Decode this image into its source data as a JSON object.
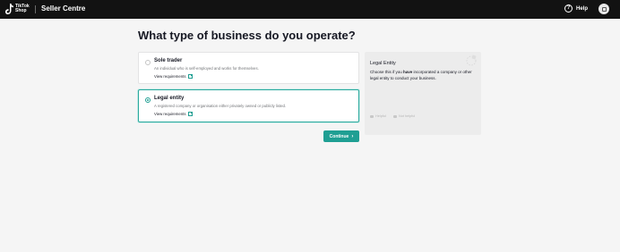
{
  "header": {
    "logo_line1": "TikTok",
    "logo_line2": "Shop",
    "brand": "Seller Centre",
    "help_label": "Help"
  },
  "main": {
    "title": "What type of business do you operate?",
    "options": [
      {
        "title": "Sole trader",
        "description": "An individual who is self-employed and works for themselves.",
        "link": "View requirements",
        "selected": false
      },
      {
        "title": "Legal entity",
        "description": "A registered company or organisation either privately owned or publicly listed.",
        "link": "View requirements",
        "selected": true
      }
    ],
    "continue_label": "Continue"
  },
  "info_panel": {
    "title": "Legal Entity",
    "text_before": "Choose this if you ",
    "text_bold": "have",
    "text_after": " incorporated a company or other legal entity to conduct your business.",
    "helpful_label": "Helpful",
    "not_helpful_label": "Not helpful"
  },
  "colors": {
    "accent": "#1f9f93",
    "topbar": "#121212",
    "background": "#f5f5f5"
  }
}
